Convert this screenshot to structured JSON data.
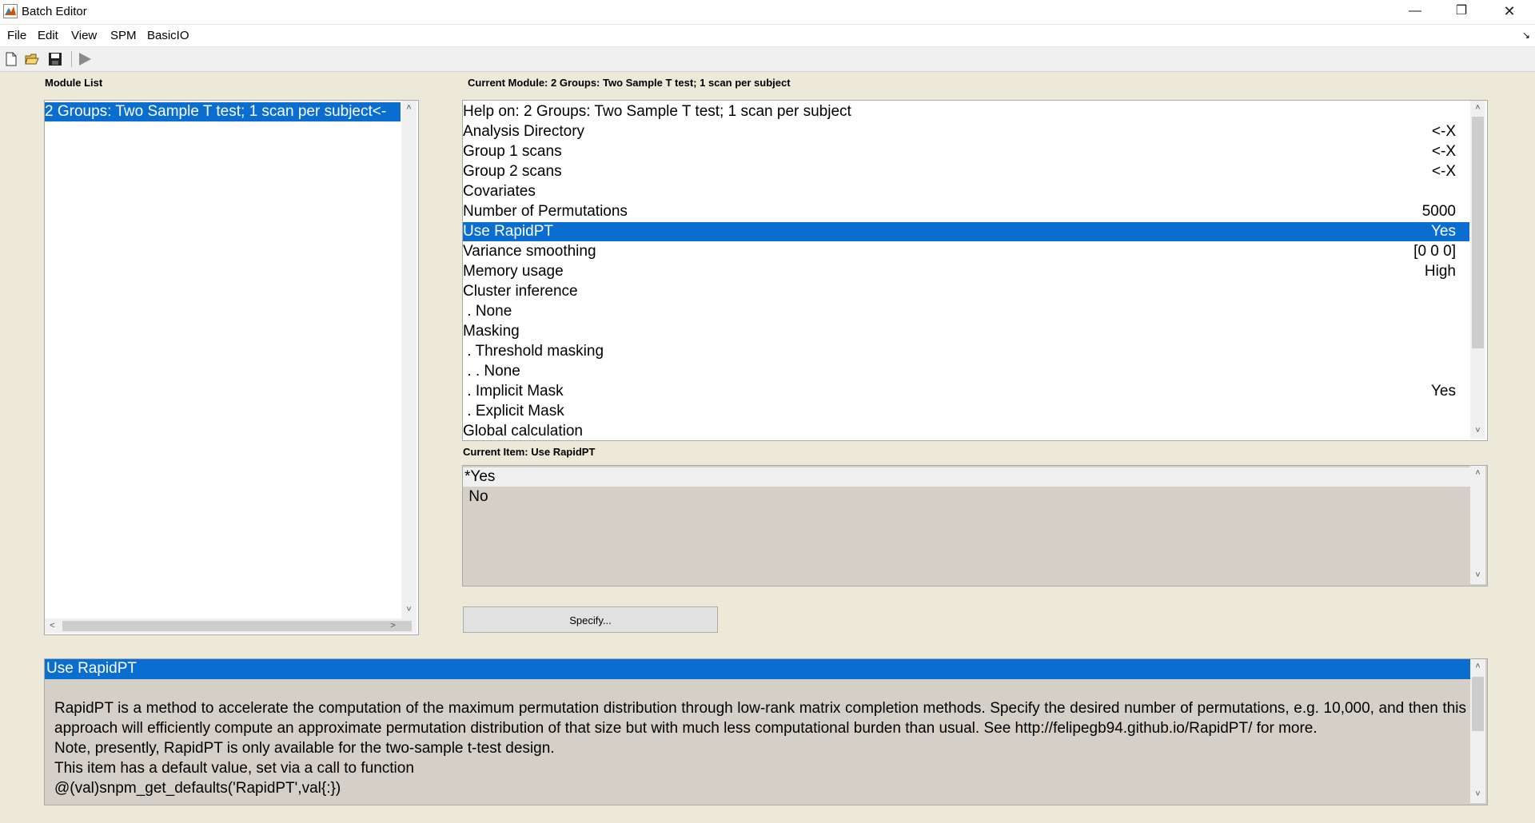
{
  "window": {
    "title": "Batch Editor",
    "minimize": "—",
    "restore": "❐",
    "close": "✕"
  },
  "menu": {
    "items": [
      "File",
      "Edit",
      "View",
      "SPM",
      "BasicIO"
    ],
    "dock": "↘"
  },
  "toolbar": {
    "icons": [
      "new-file-icon",
      "open-folder-icon",
      "save-icon",
      "run-icon"
    ]
  },
  "module_list": {
    "label": "Module List",
    "items": [
      "2 Groups: Two Sample T test; 1 scan per subject<-"
    ],
    "selected_index": 0
  },
  "current_module": {
    "label": "Current Module: 2 Groups: Two Sample T test; 1 scan per subject",
    "rows": [
      {
        "name": "Help on: 2 Groups: Two Sample T test; 1 scan per subject",
        "value": ""
      },
      {
        "name": "Analysis Directory",
        "value": "<-X"
      },
      {
        "name": "Group 1 scans",
        "value": "<-X"
      },
      {
        "name": "Group 2 scans",
        "value": "<-X"
      },
      {
        "name": "Covariates",
        "value": ""
      },
      {
        "name": "Number of Permutations",
        "value": "5000"
      },
      {
        "name": "Use RapidPT",
        "value": "Yes"
      },
      {
        "name": "Variance smoothing",
        "value": "[0 0 0]"
      },
      {
        "name": "Memory usage",
        "value": "High"
      },
      {
        "name": "Cluster inference",
        "value": ""
      },
      {
        "name": " . None",
        "value": ""
      },
      {
        "name": "Masking",
        "value": ""
      },
      {
        "name": " . Threshold masking",
        "value": ""
      },
      {
        "name": " . . None",
        "value": ""
      },
      {
        "name": " . Implicit Mask",
        "value": "Yes"
      },
      {
        "name": " . Explicit Mask",
        "value": ""
      },
      {
        "name": "Global calculation",
        "value": ""
      }
    ],
    "selected_index": 6
  },
  "current_item": {
    "label": "Current Item: Use RapidPT",
    "options": [
      "*Yes",
      " No"
    ]
  },
  "specify_button": "Specify...",
  "help": {
    "title": "Use RapidPT",
    "paragraph": "RapidPT  is  a  method to accelerate the computation of the maximum permutation distribution through low-rank matrix completion methods.  Specify the desired number of permutations, e.g. 10,000, and then this approach will efficiently compute an approximate permutation distribution of that size but with much less computational burden than usual. See http://felipegb94.github.io/RapidPT/ for more.",
    "lines": [
      "Note, presently, RapidPT is only available for the two-sample t-test design.",
      "This item has a default value, set via a call to function",
      "@(val)snpm_get_defaults('RapidPT',val{:})"
    ]
  },
  "scroll_arrows": {
    "up": "˄",
    "down": "˅",
    "left": "<",
    "right": ">"
  },
  "colors": {
    "selection": "#0a6ed1",
    "window_bg": "#ece9d8",
    "readonly_bg": "#d4d0c8"
  }
}
